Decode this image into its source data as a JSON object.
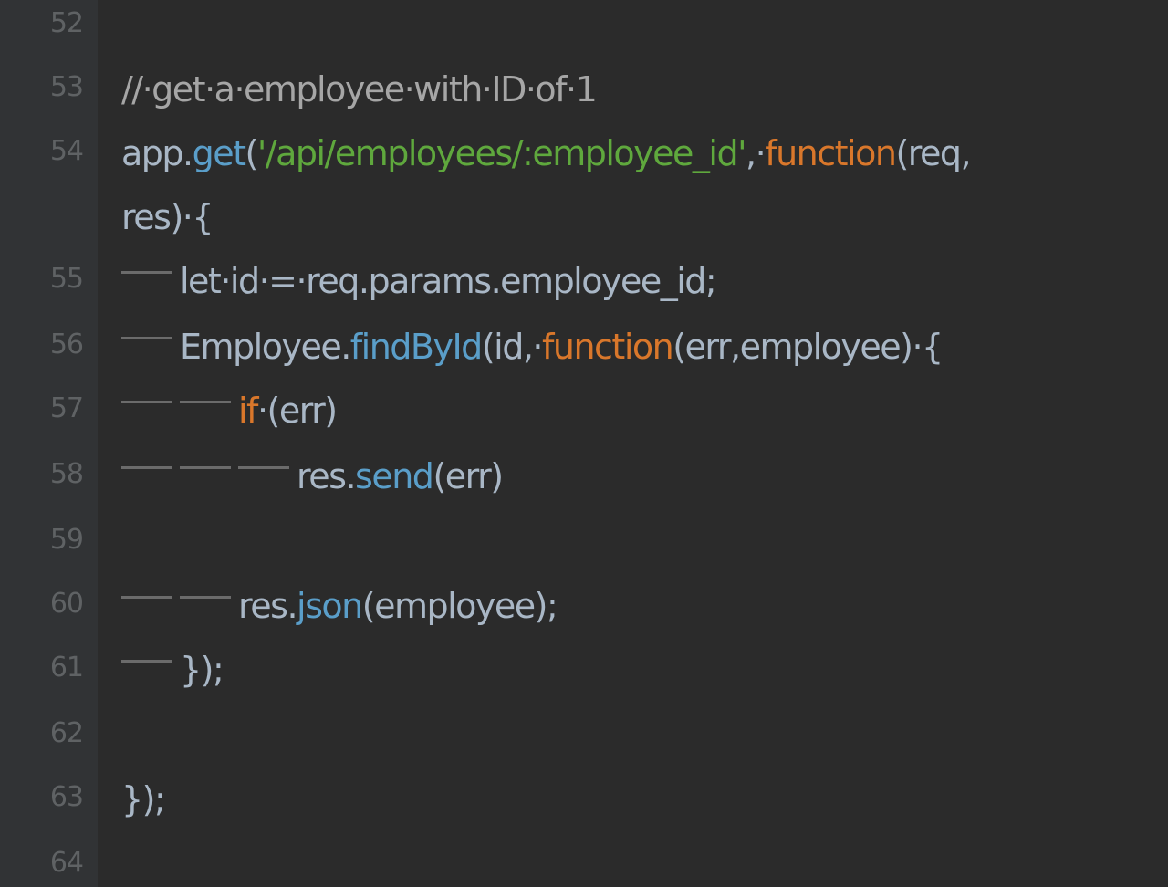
{
  "editor": {
    "gutter": {
      "line_numbers": [
        "52",
        "53",
        "54",
        "55",
        "56",
        "57",
        "58",
        "59",
        "60",
        "61",
        "62",
        "63",
        "64"
      ]
    },
    "lines": [
      {
        "number": "52",
        "tokens": []
      },
      {
        "number": "53",
        "indent": 0,
        "tokens": [
          {
            "t": "comment",
            "v": "//·get·a·employee·with·ID·of·1"
          }
        ]
      },
      {
        "number": "54",
        "indent": 0,
        "tokens": [
          {
            "t": "default",
            "v": "app."
          },
          {
            "t": "method",
            "v": "get"
          },
          {
            "t": "default",
            "v": "("
          },
          {
            "t": "string",
            "v": "'/api/employees/:employee_id'"
          },
          {
            "t": "default",
            "v": ",·"
          },
          {
            "t": "keyword",
            "v": "function"
          },
          {
            "t": "default",
            "v": "(req,"
          }
        ]
      },
      {
        "number": "",
        "indent": 0,
        "tokens": [
          {
            "t": "default",
            "v": "res)·{"
          }
        ]
      },
      {
        "number": "55",
        "indent": 1,
        "tokens": [
          {
            "t": "default",
            "v": "let·id·=·req.params.employee_id;"
          }
        ]
      },
      {
        "number": "56",
        "indent": 1,
        "tokens": [
          {
            "t": "default",
            "v": "Employee."
          },
          {
            "t": "method",
            "v": "findById"
          },
          {
            "t": "default",
            "v": "(id,·"
          },
          {
            "t": "keyword",
            "v": "function"
          },
          {
            "t": "default",
            "v": "(err,employee)·{"
          }
        ]
      },
      {
        "number": "57",
        "indent": 2,
        "tokens": [
          {
            "t": "keyword",
            "v": "if"
          },
          {
            "t": "default",
            "v": "·(err)"
          }
        ]
      },
      {
        "number": "58",
        "indent": 3,
        "tokens": [
          {
            "t": "default",
            "v": "res."
          },
          {
            "t": "method",
            "v": "send"
          },
          {
            "t": "default",
            "v": "(err)"
          }
        ]
      },
      {
        "number": "59",
        "indent": 0,
        "tokens": []
      },
      {
        "number": "60",
        "indent": 2,
        "tokens": [
          {
            "t": "default",
            "v": "res."
          },
          {
            "t": "method",
            "v": "json"
          },
          {
            "t": "default",
            "v": "(employee);"
          }
        ]
      },
      {
        "number": "61",
        "indent": 1,
        "tokens": [
          {
            "t": "default",
            "v": "});"
          }
        ]
      },
      {
        "number": "62",
        "indent": 0,
        "tokens": []
      },
      {
        "number": "63",
        "indent": 0,
        "tokens": [
          {
            "t": "default",
            "v": "});"
          }
        ]
      },
      {
        "number": "64",
        "indent": 0,
        "tokens": []
      }
    ]
  },
  "colors": {
    "background": "#2b2b2b",
    "gutter": "#313335",
    "line_number": "#5f6264",
    "default": "#a9b7c6",
    "method": "#5a9ec9",
    "string": "#5fa83d",
    "keyword": "#d9772b",
    "comment": "#a6a6a6"
  }
}
